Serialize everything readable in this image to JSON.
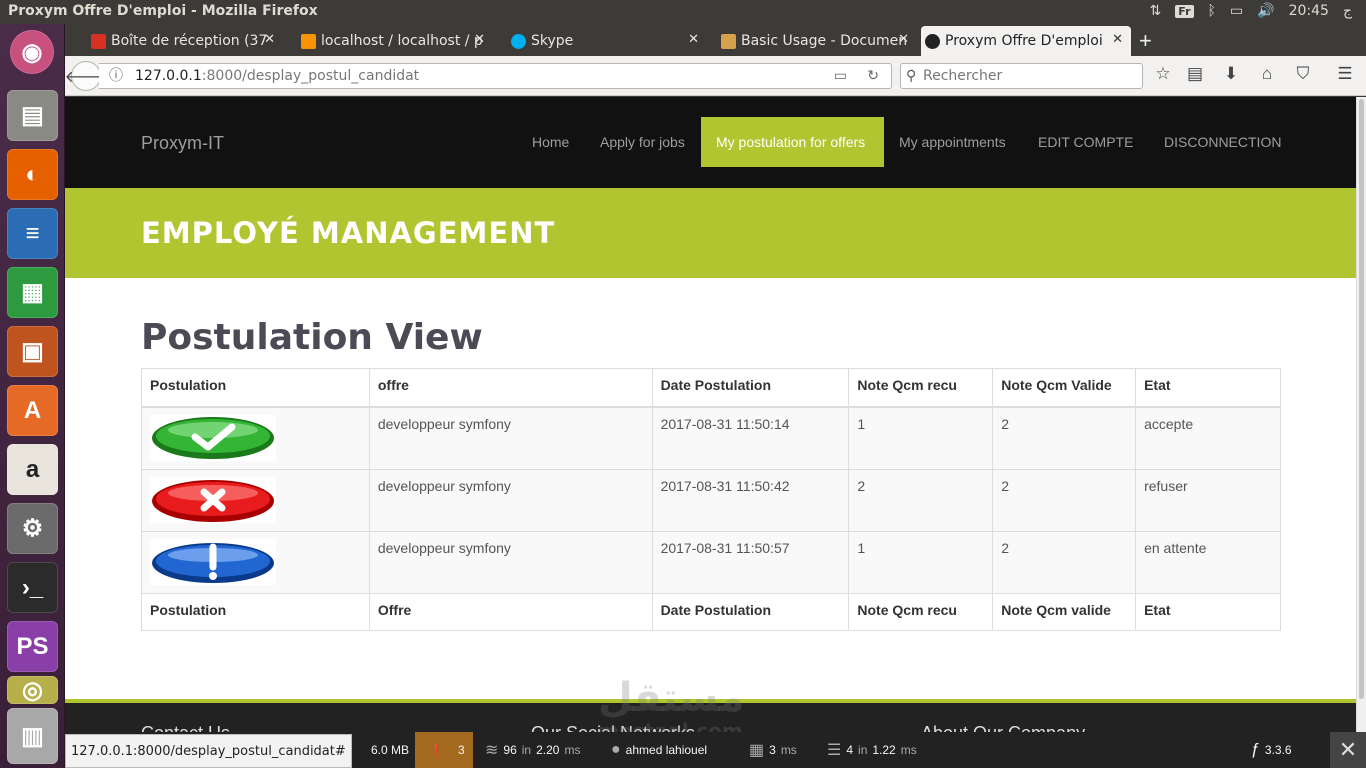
{
  "window": {
    "title": "Proxym Offre D'emploi - Mozilla Firefox"
  },
  "tray": {
    "keyboard": "Fr",
    "time": "20:45",
    "user": "ج"
  },
  "tabs": [
    {
      "label": "Boîte de réception (37",
      "favicon_color": "#d93025"
    },
    {
      "label": "localhost / localhost / p",
      "favicon_color": "#f89406"
    },
    {
      "label": "Skype",
      "favicon_color": "#00aff0"
    },
    {
      "label": "Basic Usage - Documen",
      "favicon_color": "#d6a14a"
    },
    {
      "label": "Proxym Offre D'emploi",
      "favicon_color": "#222222"
    }
  ],
  "navbar": {
    "url_host": "127.0.0.1",
    "url_path": ":8000/desplay_postul_candidat",
    "search_placeholder": "Rechercher"
  },
  "site": {
    "brand": "Proxym-IT",
    "menu": [
      "Home",
      "Apply for jobs",
      "My postulation for offers",
      "My appointments",
      "EDIT COMPTE",
      "DISCONNECTION"
    ],
    "banner": "EMPLOYÉ MANAGEMENT",
    "page_title": "Postulation View"
  },
  "table": {
    "headers": [
      "Postulation",
      "offre",
      "Date Postulation",
      "Note Qcm recu",
      "Note Qcm Valide",
      "Etat"
    ],
    "rows": [
      {
        "status_icon": "check-icon",
        "offre": "developpeur symfony",
        "date": "2017-08-31 11:50:14",
        "recu": "1",
        "valide": "2",
        "etat": "accepte"
      },
      {
        "status_icon": "cross-icon",
        "offre": "developpeur symfony",
        "date": "2017-08-31 11:50:42",
        "recu": "2",
        "valide": "2",
        "etat": "refuser"
      },
      {
        "status_icon": "exclamation-icon",
        "offre": "developpeur symfony",
        "date": "2017-08-31 11:50:57",
        "recu": "1",
        "valide": "2",
        "etat": "en attente"
      }
    ],
    "footers": [
      "Postulation",
      "Offre",
      "Date Postulation",
      "Note Qcm recu",
      "Note Qcm valide",
      "Etat"
    ]
  },
  "footer": {
    "headings": [
      "Contact Us",
      "Our Social Networks",
      "About Our Company"
    ]
  },
  "toolbar": {
    "status_url": "127.0.0.1:8000/desplay_postul_candidat#",
    "memory": "6.0 MB",
    "warnings": "3",
    "queries_count": "96",
    "queries_in": "in",
    "queries_time": "2.20",
    "ms": "ms",
    "user": "ahmed lahiouel",
    "time_ms": "3",
    "cache_count": "4",
    "cache_in": "in",
    "cache_time": "1.22",
    "version": "3.3.6"
  },
  "watermark": {
    "arabic": "مستقل",
    "latin": "mostaql.com"
  },
  "colors": {
    "accent": "#b0c52f",
    "nav_bg": "#111111",
    "launcher": "#4a2c49"
  }
}
